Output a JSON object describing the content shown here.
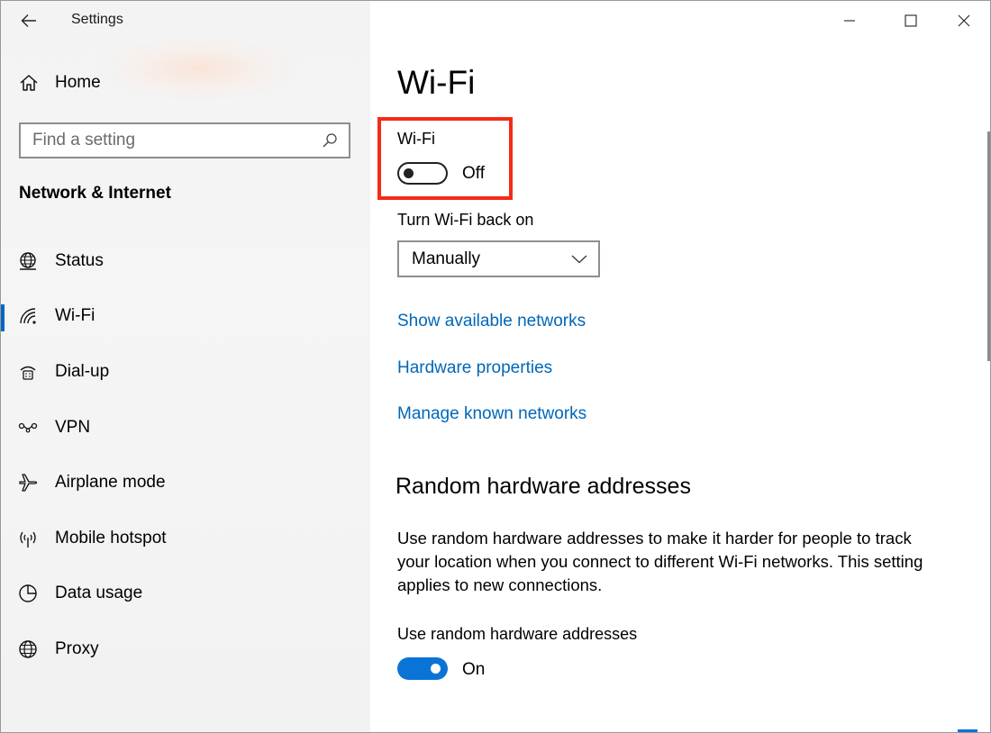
{
  "window": {
    "app_title": "Settings"
  },
  "sidebar": {
    "home_label": "Home",
    "search_placeholder": "Find a setting",
    "section_title": "Network & Internet",
    "items": [
      {
        "label": "Status",
        "icon": "globe-status-icon"
      },
      {
        "label": "Wi-Fi",
        "icon": "wifi-icon",
        "active": true
      },
      {
        "label": "Dial-up",
        "icon": "dial-up-icon"
      },
      {
        "label": "VPN",
        "icon": "vpn-icon"
      },
      {
        "label": "Airplane mode",
        "icon": "airplane-icon"
      },
      {
        "label": "Mobile hotspot",
        "icon": "hotspot-icon"
      },
      {
        "label": "Data usage",
        "icon": "data-usage-icon"
      },
      {
        "label": "Proxy",
        "icon": "globe-icon"
      }
    ]
  },
  "main": {
    "page_title": "Wi-Fi",
    "wifi_toggle": {
      "label": "Wi-Fi",
      "state": "Off"
    },
    "turn_back_on": {
      "label": "Turn Wi-Fi back on",
      "value": "Manually"
    },
    "links": [
      "Show available networks",
      "Hardware properties",
      "Manage known networks"
    ],
    "random_hw": {
      "title": "Random hardware addresses",
      "description": "Use random hardware addresses to make it harder for people to track your location when you connect to different Wi-Fi networks. This setting applies to new connections.",
      "toggle_label": "Use random hardware addresses",
      "state": "On"
    }
  },
  "colors": {
    "accent": "#0a74d6",
    "link": "#0067b8",
    "highlight_box": "#f42b16"
  }
}
